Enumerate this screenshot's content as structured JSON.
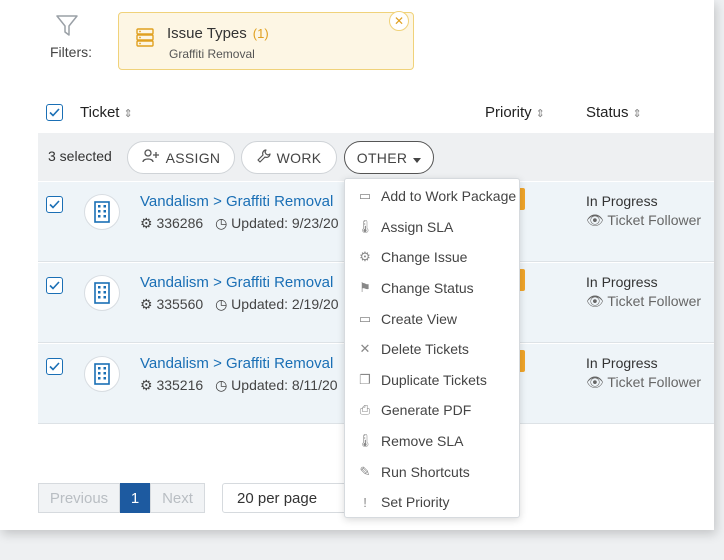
{
  "filters": {
    "label": "Filters:",
    "chip": {
      "title": "Issue Types",
      "count": "(1)",
      "value": "Graffiti Removal",
      "close": "✕"
    }
  },
  "table": {
    "headers": {
      "ticket": "Ticket",
      "priority": "Priority",
      "status": "Status"
    },
    "sort_icon": "⇕"
  },
  "actions": {
    "selected": "3 selected",
    "assign": "ASSIGN",
    "work": "WORK",
    "other": "OTHER"
  },
  "rows": [
    {
      "title": "Vandalism > Graffiti Removal",
      "id": "336286",
      "updated": "Updated: 9/23/20",
      "status": "In Progress",
      "follower": "Ticket Follower"
    },
    {
      "title": "Vandalism > Graffiti Removal",
      "id": "335560",
      "updated": "Updated: 2/19/20",
      "status": "In Progress",
      "follower": "Ticket Follower"
    },
    {
      "title": "Vandalism > Graffiti Removal",
      "id": "335216",
      "updated": "Updated: 8/11/20",
      "status": "In Progress",
      "follower": "Ticket Follower"
    }
  ],
  "menu": [
    {
      "label": "Add to Work Package",
      "icon": "briefcase-icon",
      "glyph": "▭"
    },
    {
      "label": "Assign SLA",
      "icon": "thermometer-icon",
      "glyph": "🌡"
    },
    {
      "label": "Change Issue",
      "icon": "gear-icon",
      "glyph": "⚙"
    },
    {
      "label": "Change Status",
      "icon": "flag-icon",
      "glyph": "⚑"
    },
    {
      "label": "Create View",
      "icon": "window-icon",
      "glyph": "▭"
    },
    {
      "label": "Delete Tickets",
      "icon": "x-icon",
      "glyph": "✕"
    },
    {
      "label": "Duplicate Tickets",
      "icon": "copy-icon",
      "glyph": "❐"
    },
    {
      "label": "Generate PDF",
      "icon": "printer-icon",
      "glyph": "⎙"
    },
    {
      "label": "Remove SLA",
      "icon": "thermometer-icon",
      "glyph": "🌡"
    },
    {
      "label": "Run Shortcuts",
      "icon": "magic-wand-icon",
      "glyph": "✎"
    },
    {
      "label": "Set Priority",
      "icon": "exclamation-icon",
      "glyph": "!"
    }
  ],
  "pagination": {
    "prev": "Previous",
    "page": "1",
    "next": "Next",
    "per_page": "20 per page"
  },
  "colors": {
    "link": "#1a6fb5",
    "accent": "#f0a52a",
    "chip_bg": "#fdf6e4",
    "page_active": "#1d5aa0"
  }
}
